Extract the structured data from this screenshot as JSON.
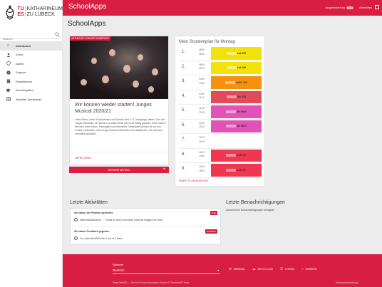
{
  "logo": {
    "line1_a": "TU",
    "line1_b": "KATHARINEUM",
    "line2_a": "ES",
    "line2_b": "ZU LÜBECK"
  },
  "search": {
    "placeholder": "Search..."
  },
  "nav": [
    {
      "label": "Dashboard",
      "icon": "home-icon",
      "active": true
    },
    {
      "label": "Konto",
      "icon": "person-icon"
    },
    {
      "label": "Admin",
      "icon": "shield-icon"
    },
    {
      "label": "Support",
      "icon": "help-icon"
    },
    {
      "label": "Klassenbuch",
      "icon": "book-icon"
    },
    {
      "label": "Stundenpläne",
      "icon": "graduation-icon"
    },
    {
      "label": "Aktueller Speiseplan",
      "icon": "menu-icon"
    }
  ],
  "topbar": {
    "title": "SchoolApps",
    "logged_in_as": "Angemeldet als",
    "logout": "Abmelden"
  },
  "page": {
    "title": "SchoolApps"
  },
  "news": {
    "badge": "AKTUELLES VON DER HOMEPAGE",
    "title": "Wir können wieder starten! Junges Musical 2020/21",
    "text": "Liebe Eltern, liebe Schülerinnen und Schüler des 5.-8. Jahrgangs, lieber Chor des Jungen Musicals, wir können es selbst noch gar nicht richtig glauben, doch nach 3 Wochen voller Ideen, Planungen und intensiver Gespräche können wir es nun endlich verkünden: Das Junge Musical 2020/2021 wird stattfinden. Wir alle sind unendlich glücklich ...",
    "more": "MEHR LESEN",
    "more_articles": "WEITERE ARTIKEL"
  },
  "timetable": {
    "title": "Mein Stundenplan für Montag",
    "link": "SMART PLAN ANZEIGEN",
    "rows": [
      {
        "num": "1.",
        "start": "08:00",
        "end": "08:45",
        "label": "Lat 209",
        "color": "#f3e20a"
      },
      {
        "num": "2.",
        "start": "08:45",
        "end": "09:30",
        "label": "Lat 209",
        "color": "#f3e20a"
      },
      {
        "num": "3.",
        "start": "09:45",
        "end": "10:30",
        "label": "GeE2 105",
        "color": "#f5910f"
      },
      {
        "num": "4.",
        "start": "10:35",
        "end": "11:20",
        "label": "Rel 103",
        "color": "#e04a5a"
      },
      {
        "num": "5.",
        "start": "11:35",
        "end": "12:20",
        "label": "Mu MuR",
        "color": "#e352b6"
      },
      {
        "num": "6.",
        "start": "12:25",
        "end": "13:10",
        "label": "Mu MuR",
        "color": "#e352b6"
      },
      {
        "num": "7.",
        "start": "13:15",
        "end": "14:00",
        "label": "",
        "color": ""
      },
      {
        "num": "8.",
        "start": "14:05",
        "end": "14:50",
        "label": "SwB 207",
        "color": "#f0374f"
      },
      {
        "num": "9.",
        "start": "14:50",
        "end": "15:35",
        "label": "SwB 207",
        "color": "#f0374f"
      }
    ]
  },
  "activities": {
    "title": "Letzte Aktivitäten",
    "items": [
      {
        "head": "Sie haben ein Problem gemeldet.",
        "tag": "Hilfe",
        "body": "Webmail/Mailserver → Portal ist nicht erreichbar | Dies ist lediglich ein Test."
      },
      {
        "head": "Sie haben Feedback gegeben.",
        "tag": "Feedback",
        "body": "You rated AlekSIS with 4 out of 5 stars."
      }
    ]
  },
  "notifications": {
    "title": "Letzte Benachrichtigungen",
    "text": "Aktuell keine Benachrichtigungen verfügbar."
  },
  "footer": {
    "lang_label": "Sprache",
    "lang_value": "Deutsch",
    "links": [
      {
        "label": "WEBMAIL",
        "icon": "mail-icon"
      },
      {
        "label": "NEXTCLOUD",
        "icon": "cloud-icon"
      },
      {
        "label": "FORUM",
        "icon": "forum-icon"
      },
      {
        "label": "WEBSITE",
        "icon": "home-icon"
      }
    ],
    "copyright": "Diese AlekSIS — The Free School Information System © The AlekSIS Team",
    "privacy": "Datenschutzerklärung"
  }
}
